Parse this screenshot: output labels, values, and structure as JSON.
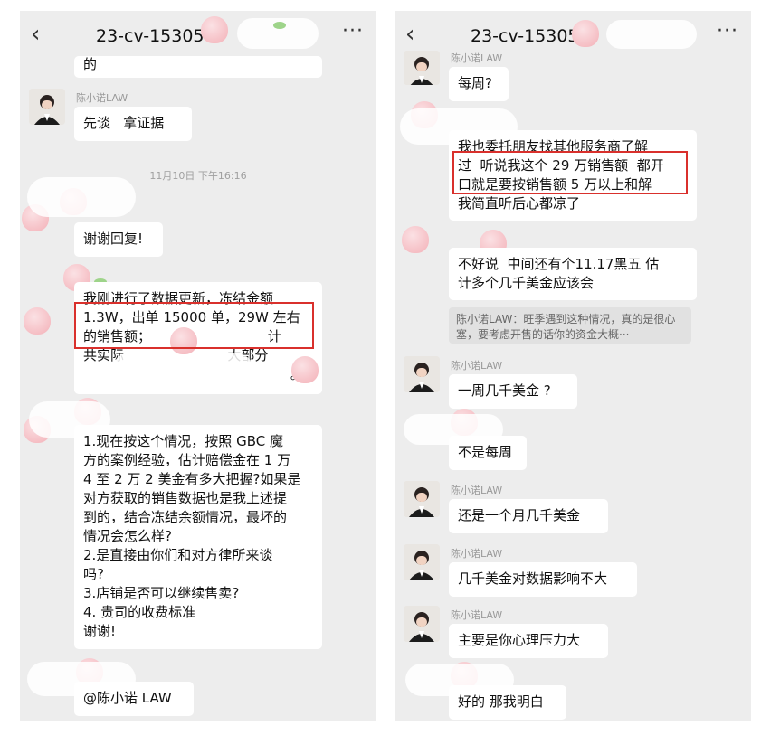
{
  "colors": {
    "highlight_box": "#d9302c",
    "panel_bg": "#ededed",
    "bubble_bg": "#ffffff"
  },
  "left": {
    "header": {
      "back_icon": "chevron-left-icon",
      "title": "23-cv-15305",
      "more_icon": "ellipsis-icon",
      "more": "···"
    },
    "msg_top_partial": "的",
    "sender1": "陈小诺LAW",
    "msg_xiantan": "先谈   拿证据",
    "timestamp": "11月10日 下午16:16",
    "msg_thanks": "谢谢回复!",
    "msg_update": [
      "我刚进行了数据更新，冻结金额",
      "1.3W，出单 15000 单，29W 左右",
      "的销售额；                           计",
      "共实际                        大部分",
      "                                                。"
    ],
    "msg_questions": [
      "1.现在按这个情况，按照 GBC 魔",
      "方的案例经验，估计赔偿金在 1 万",
      "4 至 2 万 2 美金有多大把握?如果是",
      "对方获取的销售数据也是我上述提",
      "到的，结合冻结余额情况，最坏的",
      "情况会怎么样?",
      "2.是直接由你们和对方律所来谈",
      "吗?",
      "3.店铺是否可以继续售卖?",
      "4. 贵司的收费标准",
      "谢谢!"
    ],
    "msg_mention": "@陈小诺 LAW"
  },
  "right": {
    "header": {
      "back_icon": "chevron-left-icon",
      "title": "23-cv-15305",
      "more_icon": "ellipsis-icon",
      "more": "···"
    },
    "sender_top": "陈小诺LAW",
    "msg_weekly": "每周?",
    "msg_friend": [
      "我也委托朋友找其他服务商了解",
      "过  听说我这个 29 万销售额  都开",
      "口就是要按销售额 5 万以上和解",
      "我简直听后心都凉了"
    ],
    "msg_blackfriday": [
      "不好说  中间还有个11.17黑五 估",
      "计多个几千美金应该会"
    ],
    "quote": "陈小诺LAW：旺季遇到这种情况，真的是很心塞，要考虑开售的话你的资金大概···",
    "sender2": "陈小诺LAW",
    "msg_week_thousands": "一周几千美金 ?",
    "msg_not_weekly": "不是每周",
    "sender3": "陈小诺LAW",
    "msg_monthly": "还是一个月几千美金",
    "sender4": "陈小诺LAW",
    "msg_impact": "几千美金对数据影响不大",
    "sender5": "陈小诺LAW",
    "msg_pressure": "主要是你心理压力大",
    "msg_ok": "好的 那我明白"
  }
}
